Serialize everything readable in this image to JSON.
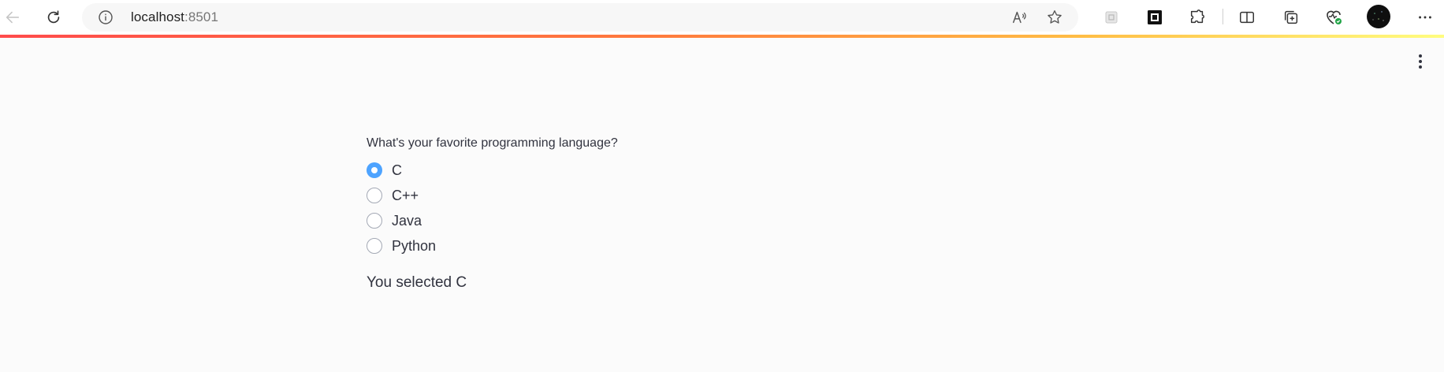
{
  "browser": {
    "url_host": "localhost",
    "url_port": ":8501"
  },
  "app": {
    "question": "What's your favorite programming language?",
    "options": [
      "C",
      "C++",
      "Java",
      "Python"
    ],
    "selected_index": 0,
    "result_text": "You selected C"
  },
  "colors": {
    "accent": "#4da3ff",
    "text": "#31333f",
    "background": "#fbfbfb"
  },
  "icons": [
    "back-arrow-icon",
    "refresh-icon",
    "site-info-icon",
    "read-aloud-icon",
    "favorite-star-icon",
    "extension-icon",
    "square-app-icon",
    "puzzle-extensions-icon",
    "split-screen-icon",
    "collections-icon",
    "browser-essentials-icon",
    "profile-avatar-icon",
    "more-options-icon",
    "page-menu-icon"
  ]
}
